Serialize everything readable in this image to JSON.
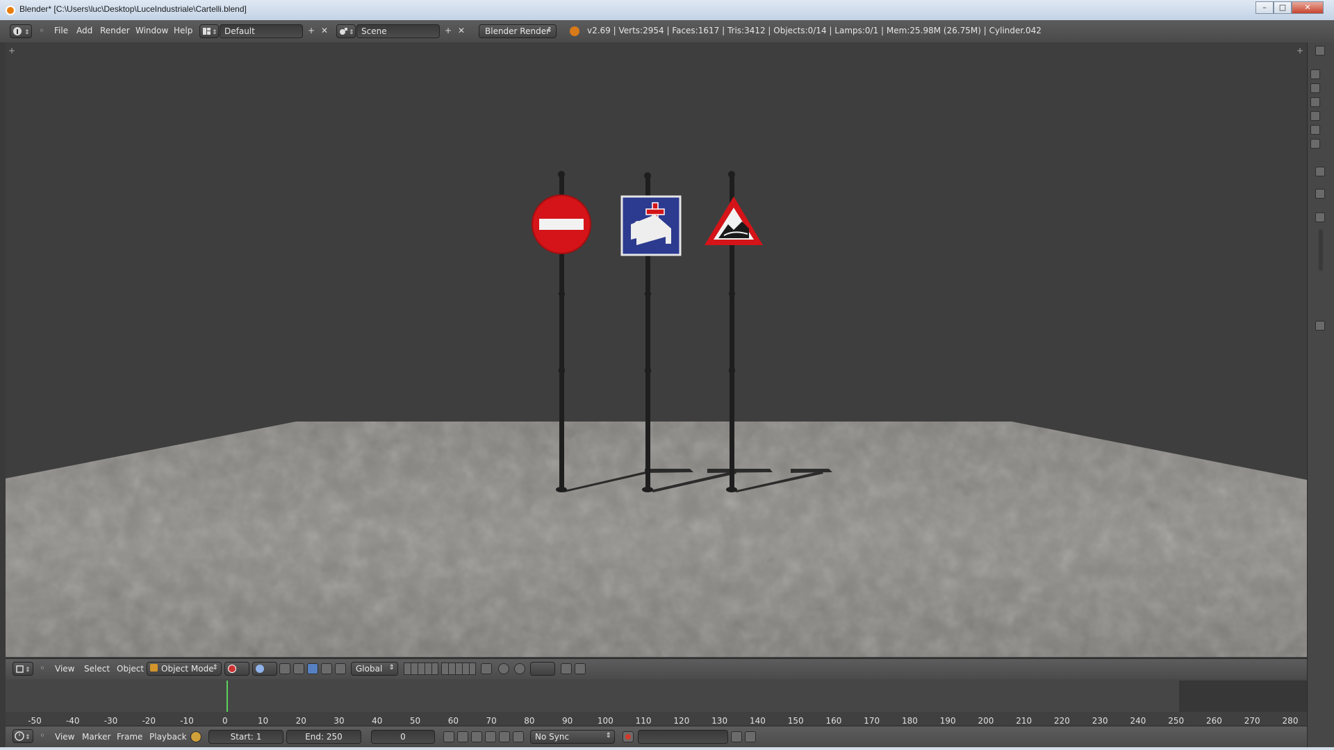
{
  "window": {
    "title": "Blender* [C:\\Users\\luc\\Desktop\\LuceIndustriale\\Cartelli.blend]",
    "min": "–",
    "max": "□",
    "close": "✕"
  },
  "infobar": {
    "menus": [
      "File",
      "Add",
      "Render",
      "Window",
      "Help"
    ],
    "layout": "Default",
    "scene": "Scene",
    "engine": "Blender Render",
    "stats": "v2.69 | Verts:2954 | Faces:1617 | Tris:3412 | Objects:0/14 | Lamps:0/1 | Mem:25.98M (26.75M) | Cylinder.042"
  },
  "viewport_header": {
    "menus": [
      "View",
      "Select",
      "Object"
    ],
    "mode": "Object Mode",
    "orientation": "Global"
  },
  "timeline": {
    "ticks": [
      "-50",
      "-40",
      "-30",
      "-20",
      "-10",
      "0",
      "10",
      "20",
      "30",
      "40",
      "50",
      "60",
      "70",
      "80",
      "90",
      "100",
      "110",
      "120",
      "130",
      "140",
      "150",
      "160",
      "170",
      "180",
      "190",
      "200",
      "210",
      "220",
      "230",
      "240",
      "250",
      "260",
      "270",
      "280"
    ],
    "menus": [
      "View",
      "Marker",
      "Frame",
      "Playback"
    ],
    "start": "Start: 1",
    "end": "End: 250",
    "current": "0",
    "sync": "No Sync"
  },
  "colors": {
    "sign_red": "#d41418",
    "sign_blue": "#2c3a8f",
    "pole": "#1e1e1e",
    "floor": "#8a8884",
    "current_frame": "#5bd15b"
  },
  "icons": [
    "info-icon",
    "layout-icon",
    "scene-icon",
    "render-icon",
    "view3d-icon",
    "object-mode-icon",
    "timeline-icon",
    "record-icon",
    "keyframe-icon"
  ]
}
